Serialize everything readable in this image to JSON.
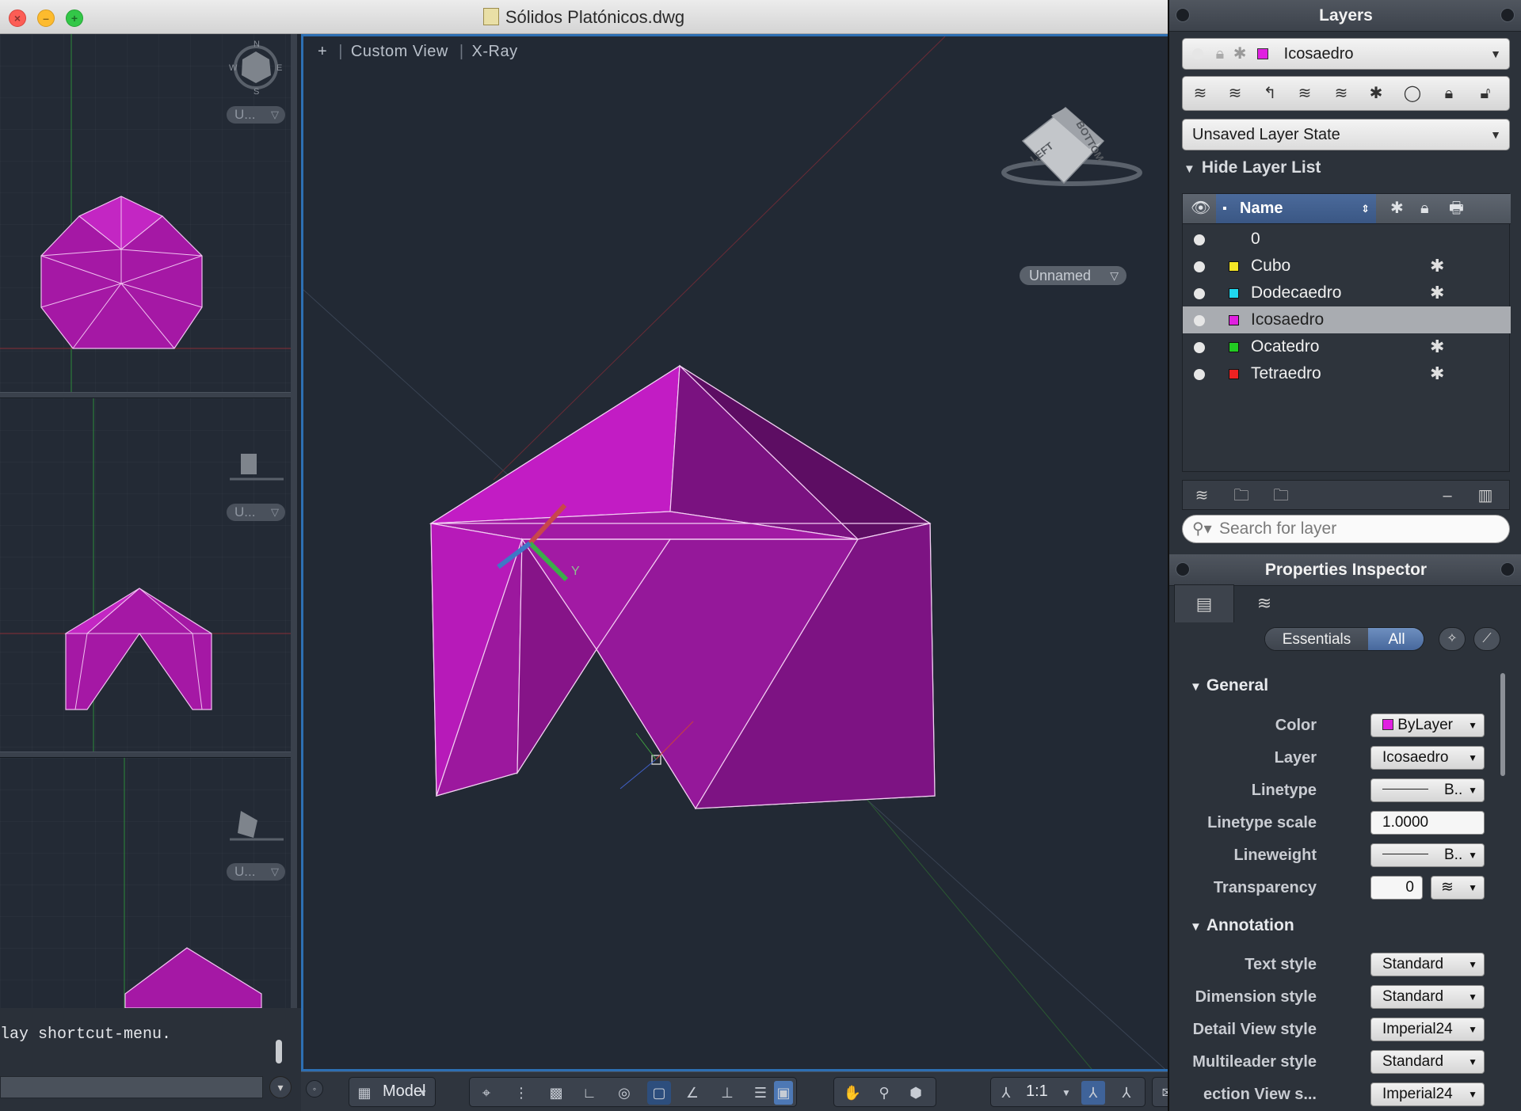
{
  "window": {
    "title": "Sólidos Platónicos.dwg"
  },
  "left_views": {
    "compass": {
      "n": "N",
      "e": "E",
      "s": "S",
      "w": "W"
    },
    "view1_dd": "U...",
    "view2_dd": "U...",
    "view3_dd": "U..."
  },
  "main_view": {
    "label_plus": "+",
    "label_view": "Custom View",
    "label_style": "X-Ray",
    "viewcube_left": "LEFT",
    "viewcube_bottom": "BOTTOM",
    "named_views": "Unnamed",
    "ucs_y": "Y",
    "face_color": "#b514b5"
  },
  "command": {
    "text": "lay shortcut-menu."
  },
  "statusbar": {
    "model_label": "Model",
    "scale_label": "1:1"
  },
  "layers": {
    "title": "Layers",
    "current_layer": "Icosaedro",
    "current_color": "#e020e0",
    "layer_state": "Unsaved Layer State",
    "hide_list_label": "Hide Layer List",
    "column_name": "Name",
    "rows": [
      {
        "name": "0",
        "color": "",
        "frozen_icon": ""
      },
      {
        "name": "Cubo",
        "color": "#f5e626",
        "frozen_icon": "✱"
      },
      {
        "name": "Dodecaedro",
        "color": "#20d8f0",
        "frozen_icon": "✱"
      },
      {
        "name": "Icosaedro",
        "color": "#e020e0",
        "frozen_icon": ""
      },
      {
        "name": "Ocatedro",
        "color": "#22cc22",
        "frozen_icon": "✱"
      },
      {
        "name": "Tetraedro",
        "color": "#ee2222",
        "frozen_icon": "✱"
      }
    ],
    "search_placeholder": "Search for layer"
  },
  "properties": {
    "title": "Properties Inspector",
    "seg_essentials": "Essentials",
    "seg_all": "All",
    "general_label": "General",
    "annotation_label": "Annotation",
    "general": {
      "color_label": "Color",
      "color_value": "ByLayer",
      "color_swatch": "#e020e0",
      "layer_label": "Layer",
      "layer_value": "Icosaedro",
      "linetype_label": "Linetype",
      "linetype_value": "B..",
      "ltscale_label": "Linetype scale",
      "ltscale_value": "1.0000",
      "lineweight_label": "Lineweight",
      "lineweight_value": "B..",
      "transparency_label": "Transparency",
      "transparency_value": "0"
    },
    "annotation": {
      "textstyle_label": "Text style",
      "textstyle_value": "Standard",
      "dimstyle_label": "Dimension style",
      "dimstyle_value": "Standard",
      "detailview_label": "Detail View style",
      "detailview_value": "Imperial24",
      "mleader_label": "Multileader style",
      "mleader_value": "Standard",
      "sectionview_label": "ection View s...",
      "sectionview_value": "Imperial24"
    }
  }
}
